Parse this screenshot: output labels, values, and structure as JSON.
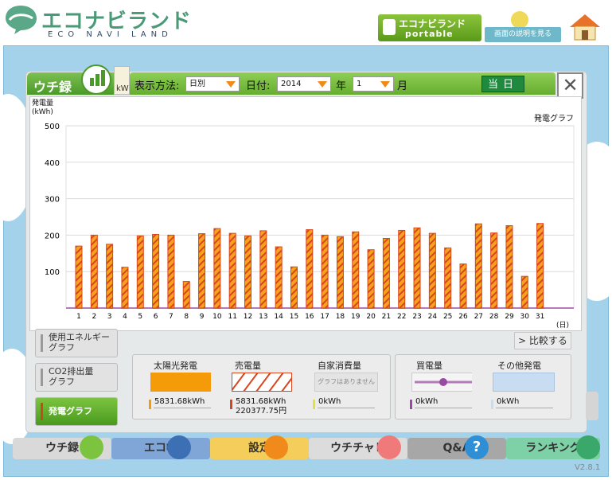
{
  "brand": {
    "logo_main": "エコナビランド",
    "logo_sub": "ECO NAVI LAND",
    "portable_line1": "エコナビランド",
    "portable_line2": "portable",
    "help_label": "画面の説明を見る"
  },
  "panel": {
    "tab_label": "ウチ録",
    "note_text": "kW",
    "display_method_label": "表示方法:",
    "display_method_value": "日別",
    "date_label": "日付:",
    "year_value": "2014",
    "year_unit": "年",
    "month_value": "1",
    "month_unit": "月",
    "today_button": "当日",
    "close_symbol": "✕"
  },
  "chart_data": {
    "type": "bar",
    "title": "発電グラフ",
    "ylabel": "発電量\n(kWh)",
    "xlabel": "(日)",
    "ylim": [
      0,
      500
    ],
    "yticks": [
      100,
      200,
      300,
      400,
      500
    ],
    "categories": [
      "1",
      "2",
      "3",
      "4",
      "5",
      "6",
      "7",
      "8",
      "9",
      "10",
      "11",
      "12",
      "13",
      "14",
      "15",
      "16",
      "17",
      "18",
      "19",
      "20",
      "21",
      "22",
      "23",
      "24",
      "25",
      "26",
      "27",
      "28",
      "29",
      "30",
      "31"
    ],
    "values": [
      170,
      200,
      175,
      112,
      198,
      202,
      200,
      73,
      204,
      218,
      205,
      198,
      212,
      168,
      113,
      215,
      200,
      196,
      209,
      160,
      191,
      213,
      220,
      205,
      165,
      121,
      231,
      206,
      226,
      87,
      232
    ],
    "colors": {
      "bar_fill": "#f5a31e",
      "bar_stripe": "#d9451e",
      "grid": "#d9d9d9"
    }
  },
  "side_buttons": [
    {
      "line1": "使用エネルギー",
      "line2": "グラフ"
    },
    {
      "line1": "CO2排出量",
      "line2": "グラフ"
    },
    {
      "line1": "発電グラフ",
      "line2": ""
    }
  ],
  "compare_button": "> 比較する",
  "legend": {
    "solar": {
      "title": "太陽光発電",
      "value": "5831.68kWh",
      "color": "#f59b0a"
    },
    "sold": {
      "title": "売電量",
      "value": "5831.68kWh",
      "value2": "220377.75円"
    },
    "self": {
      "title": "自家消費量",
      "swatch_text": "グラフはありません",
      "value": "0kWh"
    },
    "bought": {
      "title": "買電量",
      "value": "0kWh"
    },
    "other": {
      "title": "その他発電",
      "value": "0kWh"
    }
  },
  "bottom_nav": [
    {
      "label": "ウチ録",
      "color": "#d9d9d9"
    },
    {
      "label": "エコ帳",
      "color": "#7fa6d6"
    },
    {
      "label": "設定",
      "color": "#f5cd5a"
    },
    {
      "label": "ウチチャレ",
      "color": "#dcdcdc"
    },
    {
      "label": "Q&A",
      "color": "#a7a7a7"
    },
    {
      "label": "ランキング",
      "color": "#7ed0a6"
    }
  ],
  "version": "V2.8.1"
}
